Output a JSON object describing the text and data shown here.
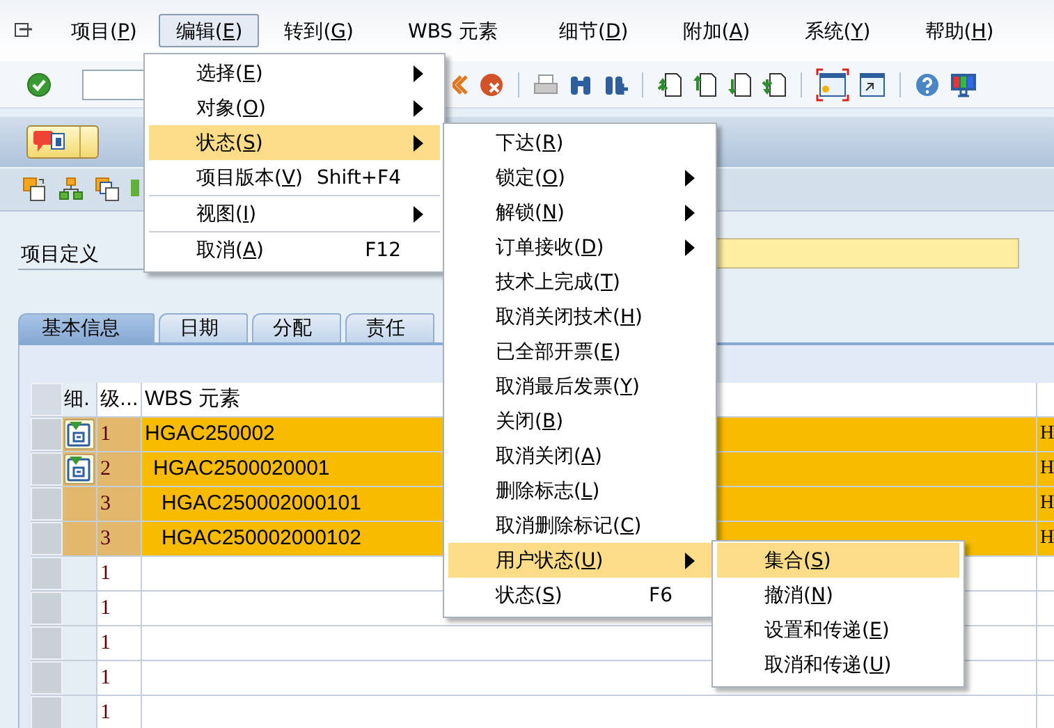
{
  "menu_bar": {
    "items": [
      {
        "label": "项目(P)",
        "selected": false
      },
      {
        "label": "编辑(E)",
        "selected": true
      },
      {
        "label": "转到(G)",
        "selected": false
      },
      {
        "label": "WBS 元素",
        "selected": false
      },
      {
        "label": "细节(D)",
        "selected": false
      },
      {
        "label": "附加(A)",
        "selected": false
      },
      {
        "label": "系统(Y)",
        "selected": false
      },
      {
        "label": "帮助(H)",
        "selected": false
      }
    ]
  },
  "header_field": {
    "label": "项目定义"
  },
  "tabs": [
    {
      "label": "基本信息",
      "selected": true
    },
    {
      "label": "日期",
      "selected": false
    },
    {
      "label": "分配",
      "selected": false
    },
    {
      "label": "责任",
      "selected": false
    }
  ],
  "table": {
    "columns": [
      "细.",
      "级...",
      "WBS 元素"
    ],
    "rows": [
      {
        "level": "1",
        "wbs_element": "HGAC250002",
        "column_4": "H",
        "selected": true,
        "detail": true,
        "children": [
          {
            "level": "2",
            "wbs_element": "HGAC2500020001",
            "column_4": "H",
            "selected": true,
            "detail": true,
            "children": [
              {
                "level": "3",
                "wbs_element": "HGAC250002000101",
                "column_4": "H",
                "selected": true,
                "detail": false
              },
              {
                "level": "3",
                "wbs_element": "HGAC250002000102",
                "column_4": "H",
                "selected": true,
                "detail": false
              }
            ]
          }
        ]
      },
      {
        "level": "1",
        "selected": false,
        "detail": false
      },
      {
        "level": "1",
        "selected": false,
        "detail": false
      },
      {
        "level": "1",
        "selected": false,
        "detail": false
      },
      {
        "level": "1",
        "selected": false,
        "detail": false
      },
      {
        "level": "1",
        "selected": false,
        "detail": false
      }
    ]
  },
  "menus": [
    {
      "items": [
        {
          "kind": "submenu",
          "label": "选择(E)",
          "selected": false
        },
        {
          "kind": "submenu",
          "label": "对象(O)",
          "selected": false
        },
        {
          "kind": "submenu",
          "label": "状态(S)",
          "selected": true
        },
        {
          "kind": "command",
          "label": "项目版本(V)",
          "shortcut": "Shift+F4",
          "selected": false
        },
        {
          "kind": "separator"
        },
        {
          "kind": "submenu",
          "label": "视图(I)",
          "selected": false
        },
        {
          "kind": "separator"
        },
        {
          "kind": "command",
          "label": "取消(A)",
          "shortcut": "F12",
          "selected": false
        }
      ]
    },
    {
      "items": [
        {
          "kind": "command",
          "label": "下达(R)",
          "selected": false
        },
        {
          "kind": "submenu",
          "label": "锁定(O)",
          "selected": false
        },
        {
          "kind": "submenu",
          "label": "解锁(N)",
          "selected": false
        },
        {
          "kind": "submenu",
          "label": "订单接收(D)",
          "selected": false
        },
        {
          "kind": "command",
          "label": "技术上完成(T)",
          "selected": false
        },
        {
          "kind": "command",
          "label": "取消关闭技术(H)",
          "selected": false
        },
        {
          "kind": "command",
          "label": "已全部开票(E)",
          "selected": false
        },
        {
          "kind": "command",
          "label": "取消最后发票(Y)",
          "selected": false
        },
        {
          "kind": "command",
          "label": "关闭(B)",
          "selected": false
        },
        {
          "kind": "command",
          "label": "取消关闭(A)",
          "selected": false
        },
        {
          "kind": "command",
          "label": "删除标志(L)",
          "selected": false
        },
        {
          "kind": "command",
          "label": "取消删除标记(C)",
          "selected": false
        },
        {
          "kind": "submenu",
          "label": "用户状态(U)",
          "selected": true
        },
        {
          "kind": "command",
          "label": "状态(S)",
          "shortcut": "F6",
          "selected": false
        }
      ]
    },
    {
      "items": [
        {
          "kind": "command",
          "label": "集合(S)",
          "selected": true
        },
        {
          "kind": "command",
          "label": "撤消(N)",
          "selected": false
        },
        {
          "kind": "command",
          "label": "设置和传递(E)",
          "selected": false
        },
        {
          "kind": "command",
          "label": "取消和传递(U)",
          "selected": false
        }
      ]
    }
  ]
}
